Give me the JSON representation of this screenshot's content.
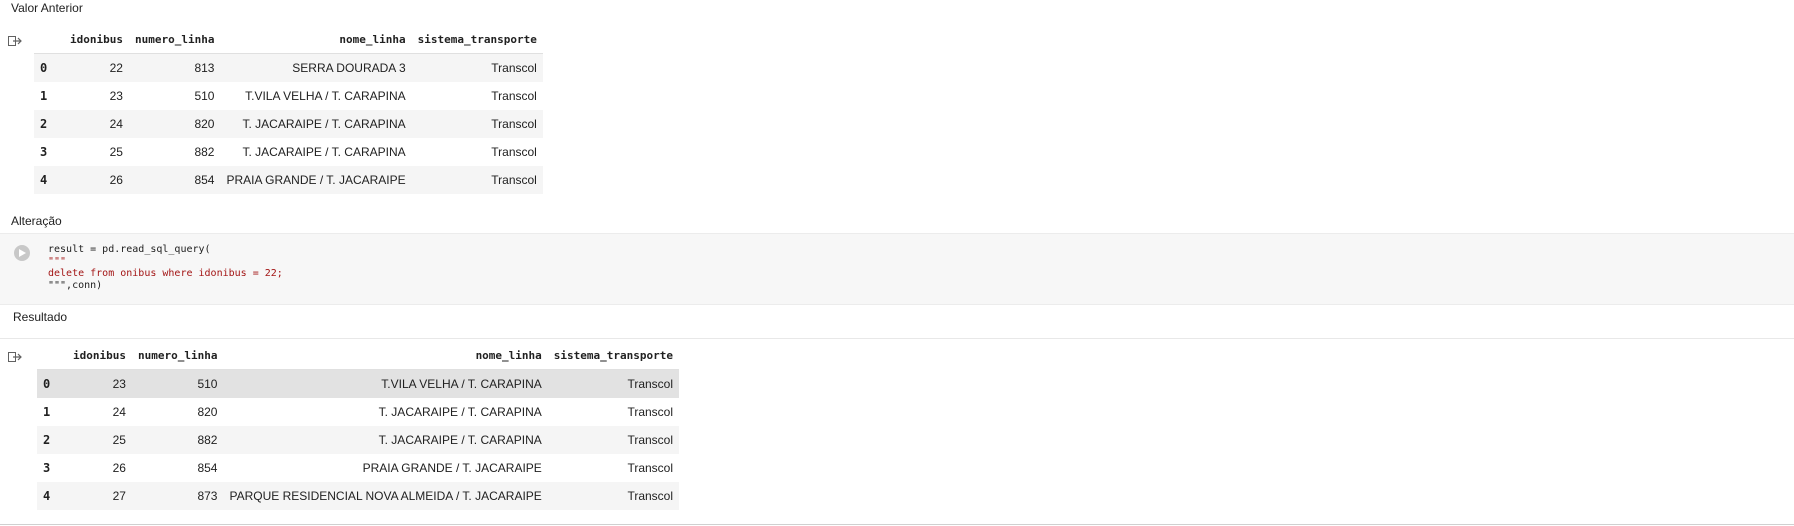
{
  "before": {
    "label": "Valor Anterior",
    "columns": [
      "",
      "idonibus",
      "numero_linha",
      "nome_linha",
      "sistema_transporte"
    ],
    "rows": [
      [
        "0",
        "22",
        "813",
        "SERRA DOURADA 3",
        "Transcol"
      ],
      [
        "1",
        "23",
        "510",
        "T.VILA VELHA / T. CARAPINA",
        "Transcol"
      ],
      [
        "2",
        "24",
        "820",
        "T. JACARAIPE / T. CARAPINA",
        "Transcol"
      ],
      [
        "3",
        "25",
        "882",
        "T. JACARAIPE / T. CARAPINA",
        "Transcol"
      ],
      [
        "4",
        "26",
        "854",
        "PRAIA GRANDE / T. JACARAIPE",
        "Transcol"
      ]
    ]
  },
  "change": {
    "label": "Alteração",
    "code_lines": [
      {
        "text": "result = pd.read_sql_query(",
        "type": "plain"
      },
      {
        "text": "\"\"\"",
        "type": "str"
      },
      {
        "text": "delete from onibus where idonibus = 22;",
        "type": "str"
      },
      {
        "text": "\"\"\",conn)",
        "type": "mixed"
      }
    ]
  },
  "result": {
    "label": "Resultado",
    "columns": [
      "",
      "idonibus",
      "numero_linha",
      "nome_linha",
      "sistema_transporte"
    ],
    "rows": [
      [
        "0",
        "23",
        "510",
        "T.VILA VELHA / T. CARAPINA",
        "Transcol"
      ],
      [
        "1",
        "24",
        "820",
        "T. JACARAIPE / T. CARAPINA",
        "Transcol"
      ],
      [
        "2",
        "25",
        "882",
        "T. JACARAIPE / T. CARAPINA",
        "Transcol"
      ],
      [
        "3",
        "26",
        "854",
        "PRAIA GRANDE / T. JACARAIPE",
        "Transcol"
      ],
      [
        "4",
        "27",
        "873",
        "PARQUE RESIDENCIAL NOVA ALMEIDA / T. JACARAIPE",
        "Transcol"
      ]
    ]
  },
  "icons": {
    "output": "output-redirect-icon",
    "run": "play-icon"
  }
}
